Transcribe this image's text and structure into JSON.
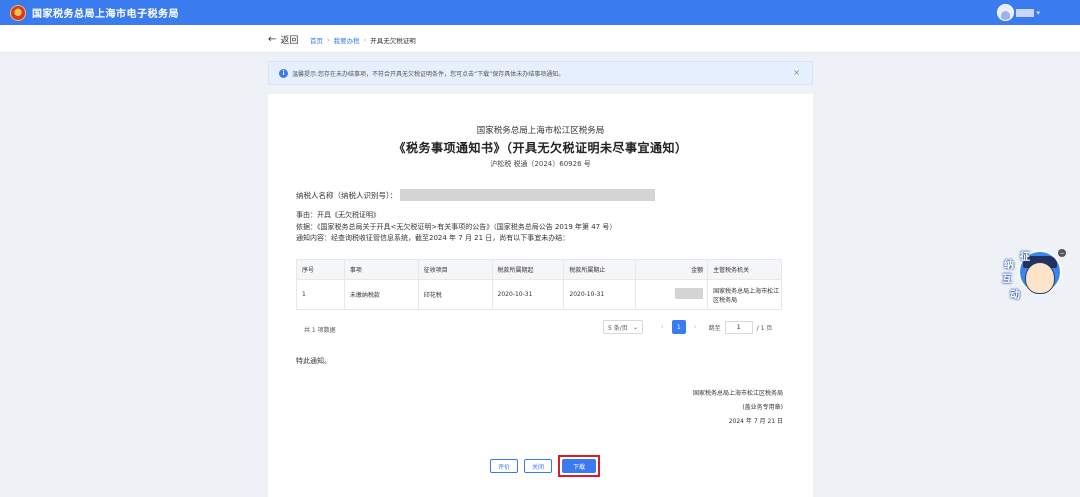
{
  "header": {
    "title": "国家税务总局上海市电子税务局"
  },
  "breadcrumb": {
    "back_label": "返回",
    "items": [
      "首页",
      "我要办税",
      "开具无欠税证明"
    ]
  },
  "notice": {
    "text": "温馨提示:您存在未办结事项，不符合开具无欠税证明条件，您可点击“下载”保存具体未办结事项通知。",
    "close": "×"
  },
  "document": {
    "org": "国家税务总局上海市松江区税务局",
    "title": "《税务事项通知书》（开具无欠税证明未尽事宜通知）",
    "doc_no": "沪松税 税通〔2024〕60926 号",
    "taxpayer_label": "纳税人名称（纳税人识别号）：",
    "lines": [
      "事由：开具《无欠税证明》",
      "依据：《国家税务总局关于开具<无欠税证明>有关事项的公告》（国家税务总局公告 2019 年第 47 号）",
      "通知内容：经查询税收征管信息系统，截至2024 年 7 月 21 日，尚有以下事宜未办结："
    ],
    "closing": "特此通知。",
    "sign_org": "国家税务总局上海市松江区税务局",
    "sign_seal": "(盖业务专用章)",
    "sign_date": "2024 年 7 月 21 日"
  },
  "table": {
    "headers": [
      "序号",
      "事项",
      "征收项目",
      "税款所属期起",
      "税款所属期止",
      "金额",
      "主管税务机关"
    ],
    "rows": [
      [
        "1",
        "未缴纳税款",
        "印花税",
        "2020-10-31",
        "2020-10-31",
        "",
        "国家税务总局上海市松江区税务局"
      ]
    ]
  },
  "pagination": {
    "total": "共 1 项数据",
    "page_size": "5 条/页",
    "current_page": "1",
    "goto_label": "跳至",
    "goto_value": "1",
    "total_pages": "/ 1 页",
    "prev": "‹",
    "next": "›"
  },
  "buttons": {
    "rate": "评价",
    "close": "关闭",
    "download": "下载"
  },
  "widget": {
    "chars": [
      "征",
      "纳",
      "互",
      "动"
    ],
    "close": "−"
  }
}
